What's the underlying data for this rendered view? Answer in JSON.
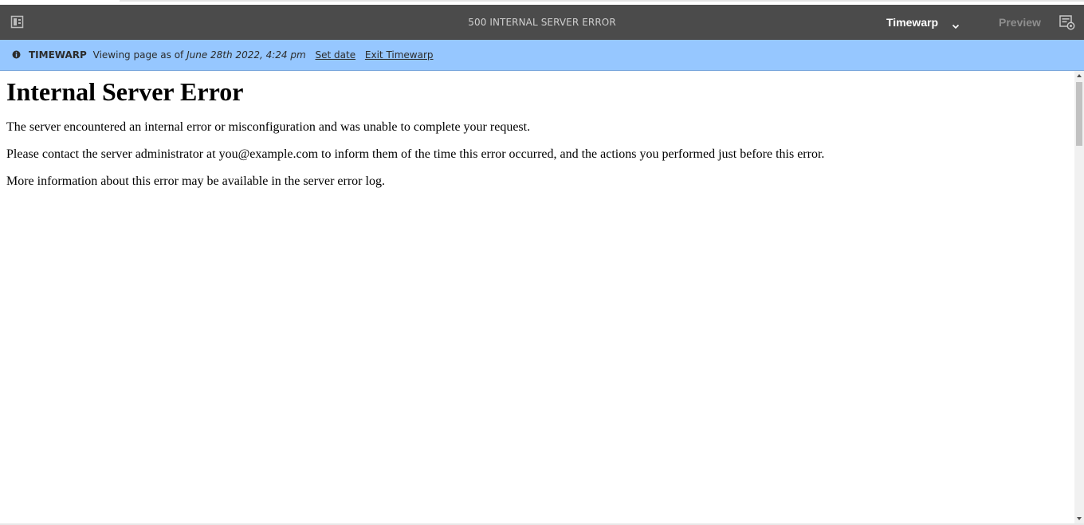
{
  "toolbar": {
    "title": "500 INTERNAL SERVER ERROR",
    "mode_label": "Timewarp",
    "preview_label": "Preview",
    "side_panel_icon": "side-panel-toggle-icon",
    "properties_icon": "page-properties-icon",
    "chevron_icon": "chevron-down-icon"
  },
  "banner": {
    "label": "TIMEWARP",
    "text": "Viewing page as of",
    "date": "June 28th 2022, 4:24 pm",
    "set_date": "Set date",
    "exit": "Exit Timewarp",
    "info_icon": "info-icon",
    "background_color": "#96c7ff"
  },
  "content": {
    "heading": "Internal Server Error",
    "paragraphs": [
      "The server encountered an internal error or misconfiguration and was unable to complete your request.",
      "Please contact the server administrator at you@example.com to inform them of the time this error occurred, and the actions you performed just before this error.",
      "More information about this error may be available in the server error log."
    ]
  },
  "colors": {
    "toolbar_bg": "#4b4b4b",
    "preview_disabled": "#8e8e8e"
  }
}
